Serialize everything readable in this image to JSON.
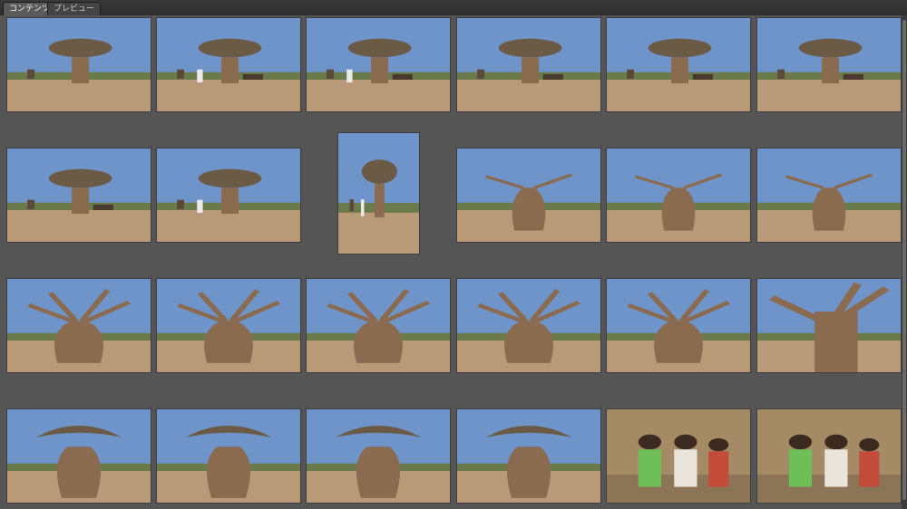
{
  "tabs": [
    {
      "label": "コンテンツ",
      "active": true
    },
    {
      "label": "プレビュー",
      "active": false
    }
  ],
  "colors": {
    "panel": "#555555",
    "sky": "#6f94c9",
    "ground": "#b89a79",
    "trunk": "#8a6b50"
  },
  "thumbnails": [
    {
      "subject": "baobab-grove-wide"
    },
    {
      "subject": "man-walking-cart"
    },
    {
      "subject": "man-walking-cart"
    },
    {
      "subject": "zebu-cart-baobabs"
    },
    {
      "subject": "zebu-cart-baobabs"
    },
    {
      "subject": "zebu-cart-baobabs"
    },
    {
      "subject": "zebu-cart-baobabs-close"
    },
    {
      "subject": "man-under-baobab"
    },
    {
      "subject": "man-portrait-baobab"
    },
    {
      "subject": "bottle-baobab"
    },
    {
      "subject": "bottle-baobab"
    },
    {
      "subject": "baobab-with-tree"
    },
    {
      "subject": "baobab-bushes"
    },
    {
      "subject": "baobab-bushes"
    },
    {
      "subject": "baobab-large-crown"
    },
    {
      "subject": "baobab-large-crown"
    },
    {
      "subject": "baobab-large-crown"
    },
    {
      "subject": "baobab-branches-closeup"
    },
    {
      "subject": "baobab-thick-trunk"
    },
    {
      "subject": "baobab-thick-trunk"
    },
    {
      "subject": "baobab-thick-trunk"
    },
    {
      "subject": "baobab-thick-trunk"
    },
    {
      "subject": "group-girls"
    },
    {
      "subject": "group-people"
    }
  ]
}
